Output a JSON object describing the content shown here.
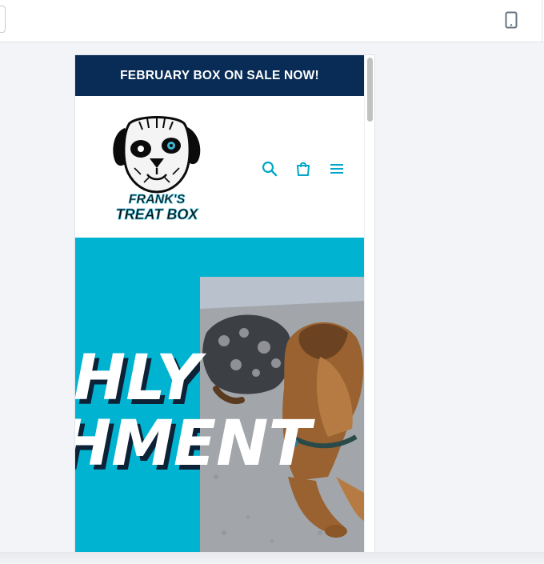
{
  "editor": {
    "device_icon": "mobile-phone-icon"
  },
  "announcement": {
    "text": "FEBRUARY BOX ON SALE NOW!",
    "bg": "#082c55"
  },
  "logo": {
    "line1": "FRANK'S",
    "line2": "TREAT BOX"
  },
  "header": {
    "icons": [
      "search-icon",
      "shopping-bag-icon",
      "hamburger-menu-icon"
    ],
    "accent": "#00a7c7"
  },
  "hero": {
    "line1": "HLY",
    "line2": "HMENT",
    "bg": "#00b3d1"
  }
}
